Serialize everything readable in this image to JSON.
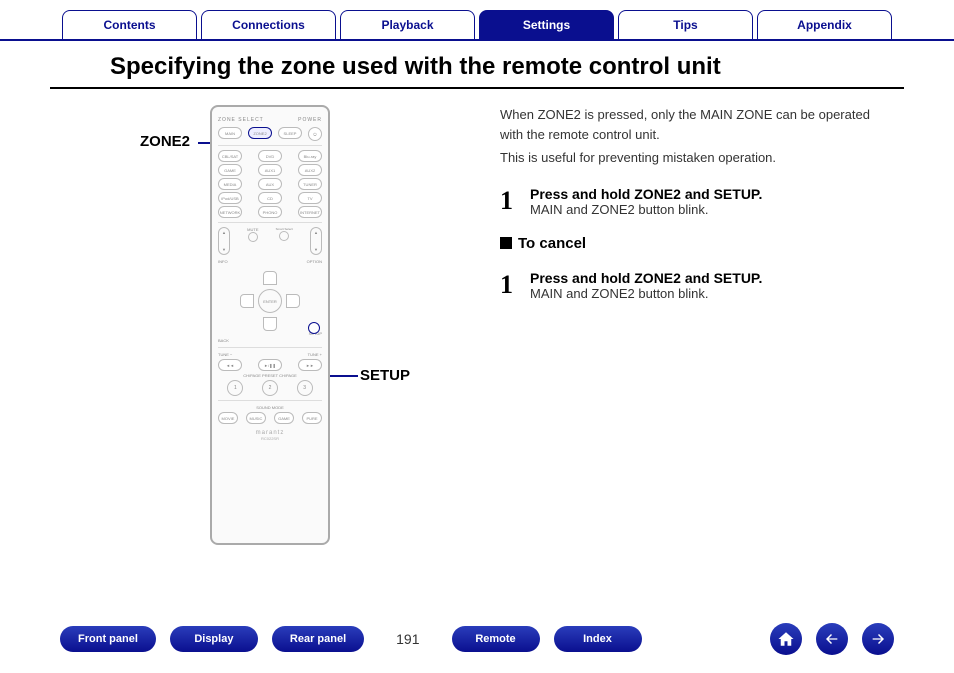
{
  "top_nav": {
    "tabs": [
      "Contents",
      "Connections",
      "Playback",
      "Settings",
      "Tips",
      "Appendix"
    ],
    "active_index": 3
  },
  "title": "Specifying the zone used with the remote control unit",
  "callouts": {
    "zone2": "ZONE2",
    "setup": "SETUP"
  },
  "remote": {
    "top_label": "ZONE SELECT",
    "power_label": "POWER",
    "dpad_center": "ENTER",
    "setup_label": "SETUP",
    "brand": "marantz",
    "model": "RC022SR",
    "presets": [
      "1",
      "2",
      "3"
    ]
  },
  "right": {
    "para1": "When ZONE2 is pressed, only the MAIN ZONE can be operated with the remote control unit.",
    "para2": "This is useful for preventing mistaken operation.",
    "step1": {
      "num": "1",
      "title": "Press and hold ZONE2 and SETUP.",
      "sub": "MAIN and ZONE2 button blink."
    },
    "cancel_heading": "To cancel",
    "step2": {
      "num": "1",
      "title": "Press and hold ZONE2 and SETUP.",
      "sub": "MAIN and ZONE2 button blink."
    }
  },
  "bottom_nav": {
    "buttons": [
      "Front panel",
      "Display",
      "Rear panel",
      "Remote",
      "Index"
    ],
    "page": "191"
  }
}
